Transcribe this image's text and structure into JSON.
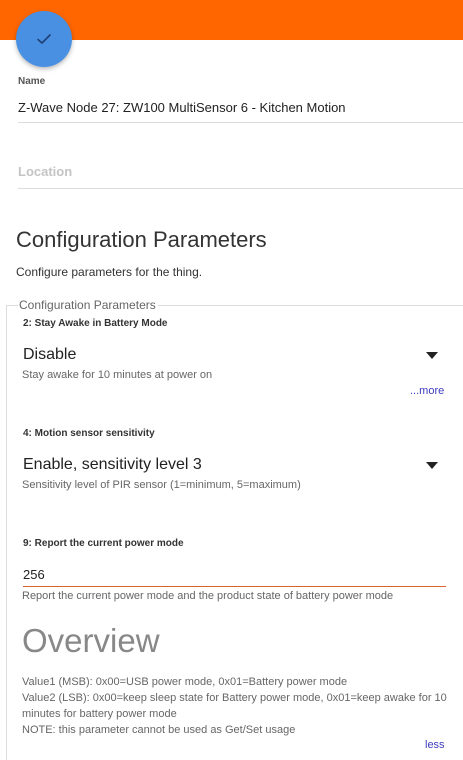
{
  "header": {
    "accent_color": "#ff6600",
    "save_icon": "check-icon",
    "save_color": "#4a90e2"
  },
  "name_field": {
    "label": "Name",
    "value": "Z-Wave Node 27: ZW100 MultiSensor 6 - Kitchen Motion"
  },
  "location_field": {
    "placeholder": "Location"
  },
  "configuration": {
    "title": "Configuration Parameters",
    "description": "Configure parameters for the thing.",
    "group_legend": "Configuration Parameters",
    "parameters": [
      {
        "label": "2: Stay Awake in Battery Mode",
        "value": "Disable",
        "help": "Stay awake for 10 minutes at power on",
        "toggle": "...more"
      },
      {
        "label": "4: Motion sensor sensitivity",
        "value": "Enable, sensitivity level 3",
        "help": "Sensitivity level of PIR sensor (1=minimum, 5=maximum)"
      },
      {
        "label": "9: Report the current power mode",
        "value": "256",
        "help": "Report the current power mode and the product state of battery power mode",
        "overview_title": "Overview",
        "overview_lines": [
          "Value1 (MSB): 0x00=USB power mode, 0x01=Battery power mode",
          "Value2 (LSB): 0x00=keep sleep state for Battery power mode, 0x01=keep awake for 10 minutes for battery power mode",
          "NOTE: this parameter cannot be used as Get/Set usage"
        ],
        "toggle": "less"
      }
    ]
  }
}
